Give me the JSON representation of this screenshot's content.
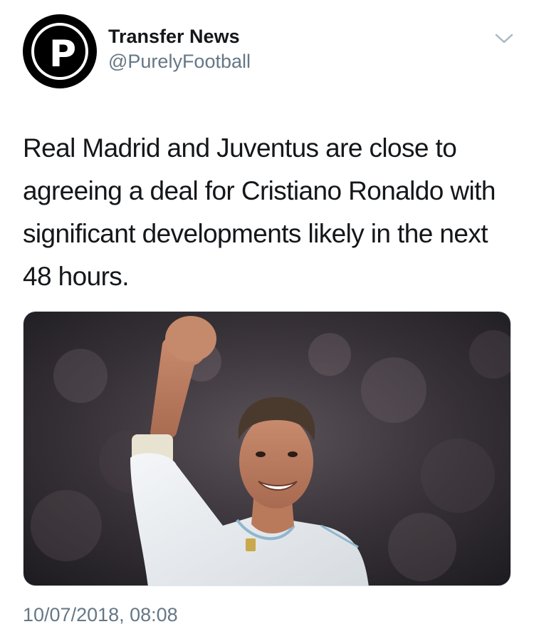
{
  "author": {
    "display_name": "Transfer News",
    "handle": "@PurelyFootball",
    "avatar_letter": "P"
  },
  "tweet": {
    "text": "Real Madrid and Juventus are close to agreeing a deal for Cristiano Ronaldo with significant developments likely in the next 48 hours.",
    "timestamp": "10/07/2018, 08:08"
  },
  "icons": {
    "menu": "chevron-down-icon",
    "avatar": "logo-p-icon"
  },
  "colors": {
    "text_primary": "#14171a",
    "text_secondary": "#657786",
    "chevron": "#aab8c2",
    "media_border": "#e1e8ed"
  }
}
